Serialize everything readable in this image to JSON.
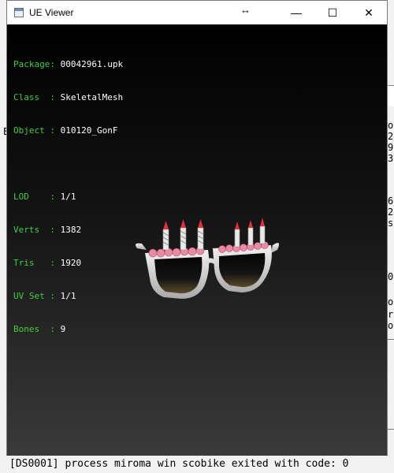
{
  "window": {
    "title": "UE Viewer",
    "resize_glyph": "↔",
    "minimize_glyph": "—",
    "maximize_glyph": "☐",
    "close_glyph": "✕"
  },
  "info": {
    "package": {
      "key": "Package: ",
      "value": "00042961.upk"
    },
    "class": {
      "key": "Class  : ",
      "value": "SkeletalMesh"
    },
    "object": {
      "key": "Object : ",
      "value": "010120_GonF"
    },
    "lod": {
      "key": "LOD    : ",
      "value": "1/1"
    },
    "verts": {
      "key": "Verts  : ",
      "value": "1382"
    },
    "tris": {
      "key": "Tris   : ",
      "value": "1920"
    },
    "uvset": {
      "key": "UV Set : ",
      "value": "1/1"
    },
    "bones": {
      "key": "Bones  : ",
      "value": "9"
    }
  },
  "background_console": {
    "side_fragments": [
      "o",
      "2",
      "9",
      "3",
      "6",
      "2",
      "s",
      "0",
      "o",
      "r",
      "o"
    ],
    "left_letter": "E",
    "bottom_line": "[DS0001] process  miroma win scobike  exited with code: 0"
  },
  "colors": {
    "key_green": "#3ecf3e",
    "value_white": "#ffffff",
    "viewport_top": "#000000",
    "viewport_bottom": "#3a3a3a"
  },
  "icons": [
    "app-icon",
    "resize-arrows-icon",
    "minimize-icon",
    "maximize-icon",
    "close-icon"
  ]
}
